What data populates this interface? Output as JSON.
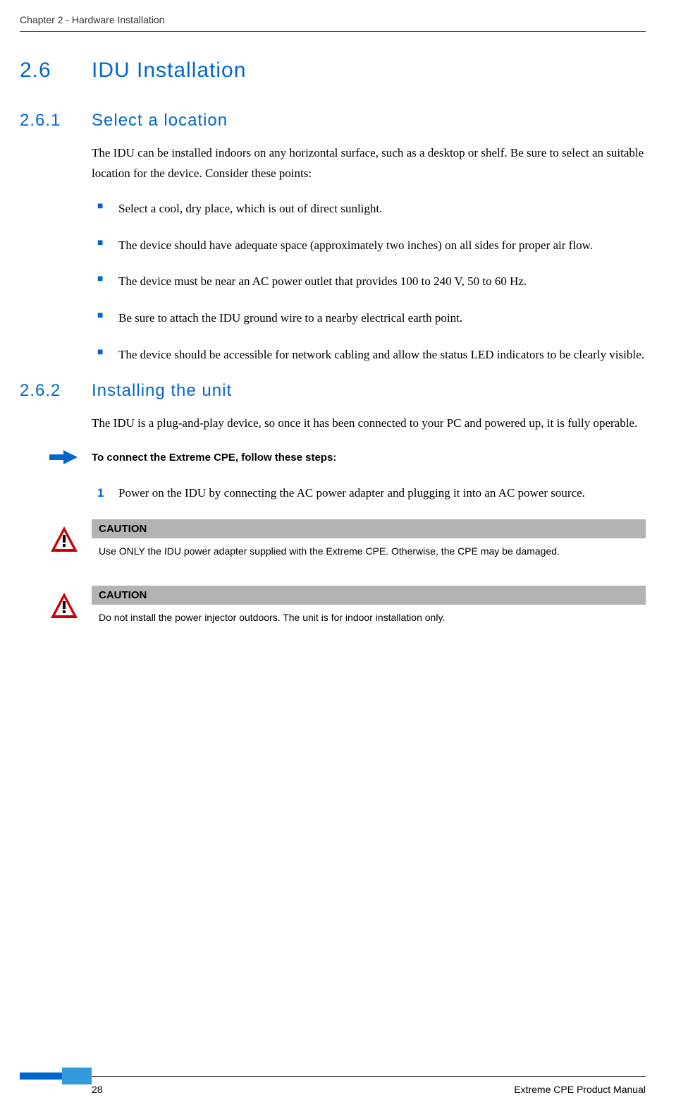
{
  "header": {
    "chapter": "Chapter 2 - Hardware Installation"
  },
  "sec_h1": {
    "num": "2.6",
    "title": "IDU Installation"
  },
  "sec_261": {
    "num": "2.6.1",
    "title": "Select a location",
    "intro": "The IDU can be installed indoors on any horizontal surface, such as a desktop or shelf. Be sure to select an suitable location for the device. Consider these points:",
    "bullets": [
      "Select a cool, dry place, which is out of direct sunlight.",
      "The device should have adequate space (approximately two inches) on all sides for proper air flow.",
      "The device must be near an AC power outlet that provides 100 to 240 V, 50 to 60 Hz.",
      "Be sure to attach the IDU ground wire to a nearby electrical earth point.",
      "The device should be accessible for network cabling and allow the status LED indicators to be clearly visible."
    ]
  },
  "sec_262": {
    "num": "2.6.2",
    "title": "Installing the unit",
    "intro": "The  IDU is a plug-and-play device, so once it has been connected to your PC and powered up, it is fully operable.",
    "steps_heading": "To connect the Extreme CPE, follow these steps:",
    "step1_num": "1",
    "step1": "Power on the IDU by connecting the AC power adapter and plugging it into an AC power source."
  },
  "caution1": {
    "label": "CAUTION",
    "text": "Use ONLY the IDU power adapter supplied with the Extreme CPE. Otherwise, the CPE  may be damaged."
  },
  "caution2": {
    "label": "CAUTION",
    "text": "Do not install the power injector outdoors. The unit is for indoor installation only."
  },
  "footer": {
    "page_num": "28",
    "doc_title": "Extreme CPE Product Manual"
  }
}
